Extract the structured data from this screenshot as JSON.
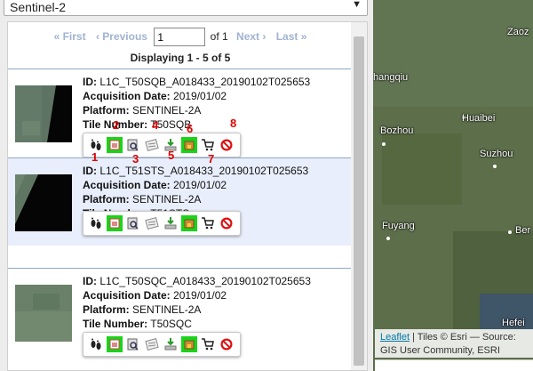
{
  "dataset": {
    "selected": "Sentinel-2"
  },
  "pager": {
    "first": "« First",
    "previous": "‹ Previous",
    "page_value": "1",
    "of_label": "of 1",
    "next": "Next ›",
    "last": "Last »",
    "displaying": "Displaying 1 - 5 of 5"
  },
  "labels": {
    "id": "ID:",
    "acq": "Acquisition Date:",
    "platform": "Platform:",
    "tile": "Tile Number:"
  },
  "items": [
    {
      "id": "L1C_T50SQB_A018433_20190102T025653",
      "date": "2019/01/02",
      "platform": "SENTINEL-2A",
      "tile": "T50SQB"
    },
    {
      "id": "L1C_T51STS_A018433_20190102T025653",
      "date": "2019/01/02",
      "platform": "SENTINEL-2A",
      "tile": "T51STS"
    },
    {
      "id": "L1C_T50SQC_A018433_20190102T025653",
      "date": "2019/01/02",
      "platform": "SENTINEL-2A",
      "tile": "T50SQC"
    }
  ],
  "annotations": [
    "1",
    "2",
    "3",
    "4",
    "5",
    "6",
    "7",
    "8"
  ],
  "map": {
    "cities": [
      "Zaoz",
      "hangqiu",
      "Huaibei",
      "Bozhou",
      "Suzhou",
      "Fuyang",
      "Ber",
      "Hefei"
    ],
    "attribution_link": "Leaflet",
    "attribution_rest": "| Tiles © Esri — Source:",
    "attribution_line2": "GIS User Community, ESRI"
  }
}
